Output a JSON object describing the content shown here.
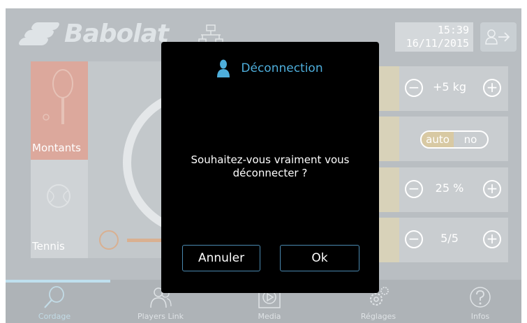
{
  "header": {
    "brand": "Babolat",
    "time": "15:39",
    "date": "16/11/2015"
  },
  "sports": [
    {
      "label": "Montants"
    },
    {
      "label": "Tennis"
    }
  ],
  "controls": {
    "weight": "+5 kg",
    "auto_on": "auto",
    "auto_off": "no",
    "percent": "25 %",
    "ratio": "5/5"
  },
  "nav": [
    {
      "label": "Cordage",
      "icon": "racket-search-icon"
    },
    {
      "label": "Players Link",
      "icon": "players-icon"
    },
    {
      "label": "Media",
      "icon": "play-icon"
    },
    {
      "label": "Réglages",
      "icon": "gears-icon"
    },
    {
      "label": "Infos",
      "icon": "question-icon"
    }
  ],
  "modal": {
    "title": "Déconnection",
    "message": "Souhaitez-vous vraiment vous déconnecter ?",
    "cancel_label": "Annuler",
    "ok_label": "Ok"
  },
  "colors": {
    "accent": "#4eaedb",
    "button_border": "#4a89b0",
    "modal_bg": "#000000",
    "dim_bg": "#b9bec2"
  }
}
